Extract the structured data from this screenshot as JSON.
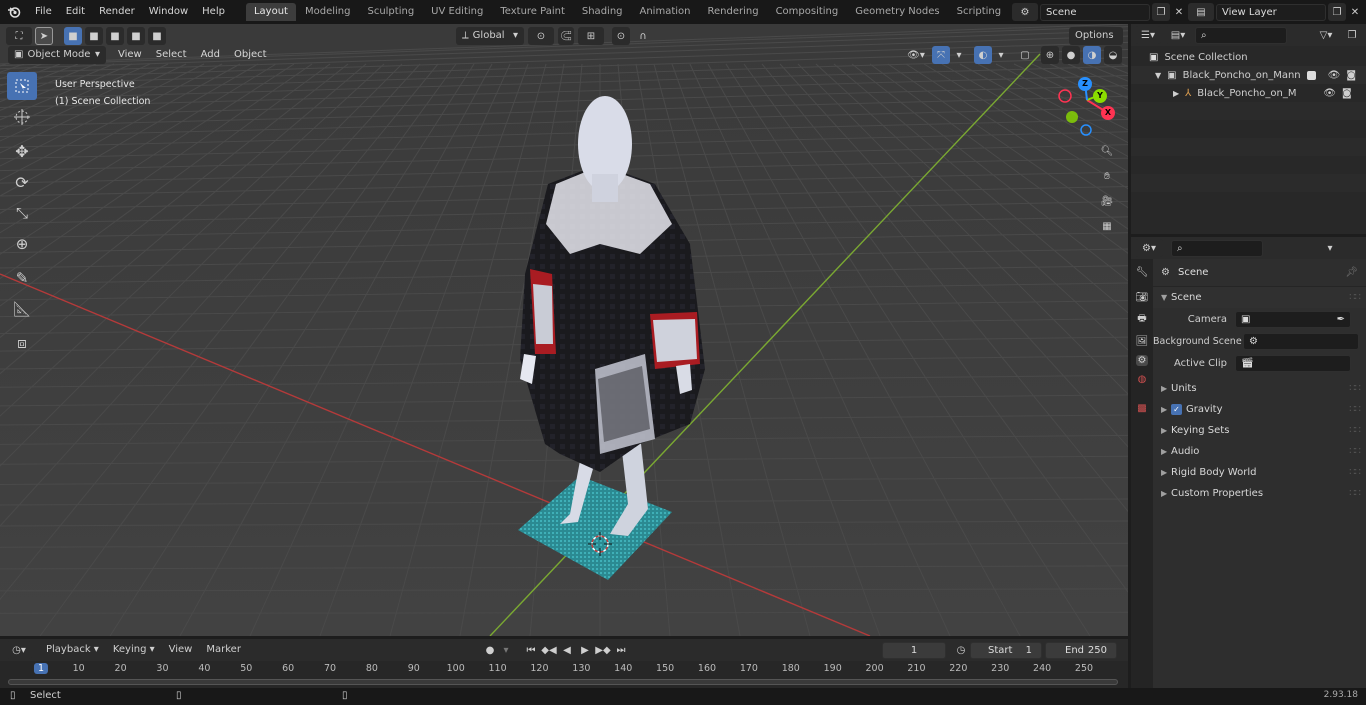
{
  "menu": [
    "File",
    "Edit",
    "Render",
    "Window",
    "Help"
  ],
  "workspaces": [
    "Layout",
    "Modeling",
    "Sculpting",
    "UV Editing",
    "Texture Paint",
    "Shading",
    "Animation",
    "Rendering",
    "Compositing",
    "Geometry Nodes",
    "Scripting"
  ],
  "active_workspace": "Layout",
  "scene_field": "Scene",
  "view_layer_field": "View Layer",
  "viewport": {
    "mode": "Object Mode",
    "menus": [
      "View",
      "Select",
      "Add",
      "Object"
    ],
    "transform_orientation": "Global",
    "options_label": "Options",
    "overlay_line1": "User Perspective",
    "overlay_line2": "(1) Scene Collection",
    "gizmo_x": "X",
    "gizmo_y": "Y",
    "gizmo_z": "Z"
  },
  "outliner": {
    "root": "Scene Collection",
    "items": [
      {
        "label": "Black_Poncho_on_Mannequin",
        "depth": 1
      },
      {
        "label": "Black_Poncho_on_Manne",
        "depth": 2
      }
    ]
  },
  "properties": {
    "header": "Scene",
    "section": "Scene",
    "fields": [
      {
        "label": "Camera",
        "value": ""
      },
      {
        "label": "Background Scene",
        "value": ""
      },
      {
        "label": "Active Clip",
        "value": ""
      }
    ],
    "panels": [
      "Units",
      "Gravity",
      "Keying Sets",
      "Audio",
      "Rigid Body World",
      "Custom Properties"
    ],
    "gravity_checked": true
  },
  "timeline": {
    "menus": [
      "Playback",
      "Keying",
      "View",
      "Marker"
    ],
    "current_frame": "1",
    "start_label": "Start",
    "start_value": "1",
    "end_label": "End",
    "end_value": "250",
    "ruler": [
      "1",
      "10",
      "20",
      "30",
      "40",
      "50",
      "60",
      "70",
      "80",
      "90",
      "100",
      "110",
      "120",
      "130",
      "140",
      "150",
      "160",
      "170",
      "180",
      "190",
      "200",
      "210",
      "220",
      "230",
      "240",
      "250"
    ]
  },
  "status": {
    "left": "Select",
    "version": "2.93.18"
  },
  "colors": {
    "accent": "#4772b3",
    "x_axis": "#ff3352",
    "y_axis": "#8bdc00",
    "z_axis": "#2890ff"
  }
}
